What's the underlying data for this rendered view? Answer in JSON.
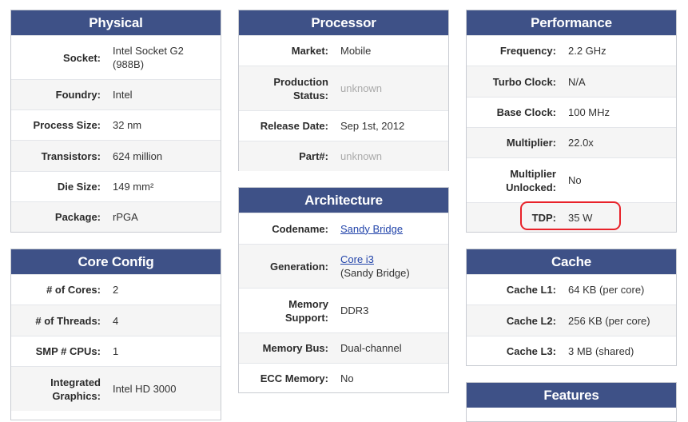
{
  "physical": {
    "title": "Physical",
    "rows": [
      {
        "label": "Socket:",
        "value": "Intel Socket G2 (988B)"
      },
      {
        "label": "Foundry:",
        "value": "Intel"
      },
      {
        "label": "Process Size:",
        "value": "32 nm"
      },
      {
        "label": "Transistors:",
        "value": "624 million"
      },
      {
        "label": "Die Size:",
        "value": "149 mm²"
      },
      {
        "label": "Package:",
        "value": "rPGA"
      }
    ]
  },
  "core_config": {
    "title": "Core Config",
    "rows": [
      {
        "label": "# of Cores:",
        "value": "2"
      },
      {
        "label": "# of Threads:",
        "value": "4"
      },
      {
        "label": "SMP # CPUs:",
        "value": "1"
      },
      {
        "label": "Integrated Graphics:",
        "value": "Intel HD 3000"
      }
    ]
  },
  "processor": {
    "title": "Processor",
    "rows": [
      {
        "label": "Market:",
        "value": "Mobile"
      },
      {
        "label": "Production Status:",
        "value": "unknown"
      },
      {
        "label": "Release Date:",
        "value": "Sep 1st, 2012"
      },
      {
        "label": "Part#:",
        "value": "unknown"
      }
    ]
  },
  "architecture": {
    "title": "Architecture",
    "rows": [
      {
        "label": "Codename:",
        "value": "Sandy Bridge"
      },
      {
        "label": "Generation:",
        "value": "Core i3",
        "sub": "(Sandy Bridge)"
      },
      {
        "label": "Memory Support:",
        "value": "DDR3"
      },
      {
        "label": "Memory Bus:",
        "value": "Dual-channel"
      },
      {
        "label": "ECC Memory:",
        "value": "No"
      }
    ]
  },
  "performance": {
    "title": "Performance",
    "rows": [
      {
        "label": "Frequency:",
        "value": "2.2 GHz"
      },
      {
        "label": "Turbo Clock:",
        "value": "N/A"
      },
      {
        "label": "Base Clock:",
        "value": "100 MHz"
      },
      {
        "label": "Multiplier:",
        "value": "22.0x"
      },
      {
        "label": "Multiplier Unlocked:",
        "value": "No"
      },
      {
        "label": "TDP:",
        "value": "35 W"
      }
    ]
  },
  "cache": {
    "title": "Cache",
    "rows": [
      {
        "label": "Cache L1:",
        "value": "64 KB (per core)"
      },
      {
        "label": "Cache L2:",
        "value": "256 KB (per core)"
      },
      {
        "label": "Cache L3:",
        "value": "3 MB (shared)"
      }
    ]
  },
  "features": {
    "title": "Features"
  },
  "colors": {
    "header_bg": "#3e5187",
    "link": "#2244aa",
    "highlight": "#e8222a"
  }
}
